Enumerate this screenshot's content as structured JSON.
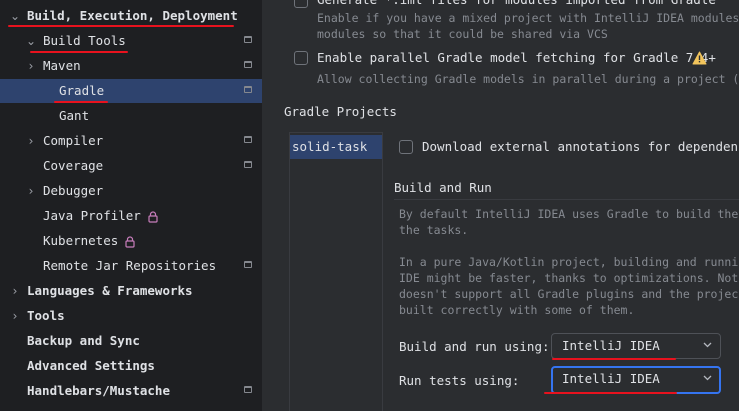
{
  "sidebar": {
    "items": [
      {
        "label": "Build, Execution, Deployment",
        "arrow": "⌄",
        "bold": true
      },
      {
        "label": "Build Tools",
        "arrow": "⌄",
        "icon": "project-icon"
      },
      {
        "label": "Maven",
        "arrow": "›",
        "icon": "project-icon"
      },
      {
        "label": "Gradle",
        "selected": true,
        "icon": "project-icon"
      },
      {
        "label": "Gant"
      },
      {
        "label": "Compiler",
        "arrow": "›",
        "icon": "project-icon"
      },
      {
        "label": "Coverage",
        "icon": "project-icon"
      },
      {
        "label": "Debugger",
        "arrow": "›"
      },
      {
        "label": "Java Profiler",
        "icon": "lock-icon"
      },
      {
        "label": "Kubernetes",
        "icon": "lock-icon"
      },
      {
        "label": "Remote Jar Repositories",
        "icon": "project-icon"
      },
      {
        "label": "Languages & Frameworks",
        "arrow": "›",
        "bold": true
      },
      {
        "label": "Tools",
        "arrow": "›",
        "bold": true
      },
      {
        "label": "Backup and Sync",
        "bold": true
      },
      {
        "label": "Advanced Settings",
        "bold": true
      },
      {
        "label": "Handlebars/Mustache",
        "bold": true,
        "icon": "project-icon"
      }
    ]
  },
  "content": {
    "top_option": {
      "label_partial": "Generate *.iml files for modules imported from Gradle",
      "desc_line1": "Enable if you have a mixed project with IntelliJ IDEA modules",
      "desc_line2": "modules so that it could be shared via VCS"
    },
    "parallel_option": {
      "label": "Enable parallel Gradle model fetching for Gradle 7.4+",
      "desc": "Allow collecting Gradle models in parallel during a project (",
      "warning_icon": "warning-icon"
    },
    "gradle_projects": {
      "heading": "Gradle Projects",
      "items": [
        "solid-task"
      ]
    },
    "download_annotations": {
      "label": "Download external annotations for dependencies"
    },
    "build_and_run": {
      "heading": "Build and Run",
      "desc1_line1": "By default IntelliJ IDEA uses Gradle to build the",
      "desc1_line2": "the tasks.",
      "desc2_line1": "In a pure Java/Kotlin project, building and runni",
      "desc2_line2": "IDE might be faster, thanks to optimizations. Not",
      "desc2_line3": "doesn't support all Gradle plugins and the projec",
      "desc2_line4": "built correctly with some of them.",
      "build_run_label": "Build and run using:",
      "build_run_value": "IntelliJ IDEA",
      "run_tests_label": "Run tests using:",
      "run_tests_value": "IntelliJ IDEA"
    }
  },
  "colors": {
    "selection": "#2e436e",
    "annotation_red": "#e8121e",
    "focus": "#3574f0",
    "warning": "#f2c55c"
  }
}
